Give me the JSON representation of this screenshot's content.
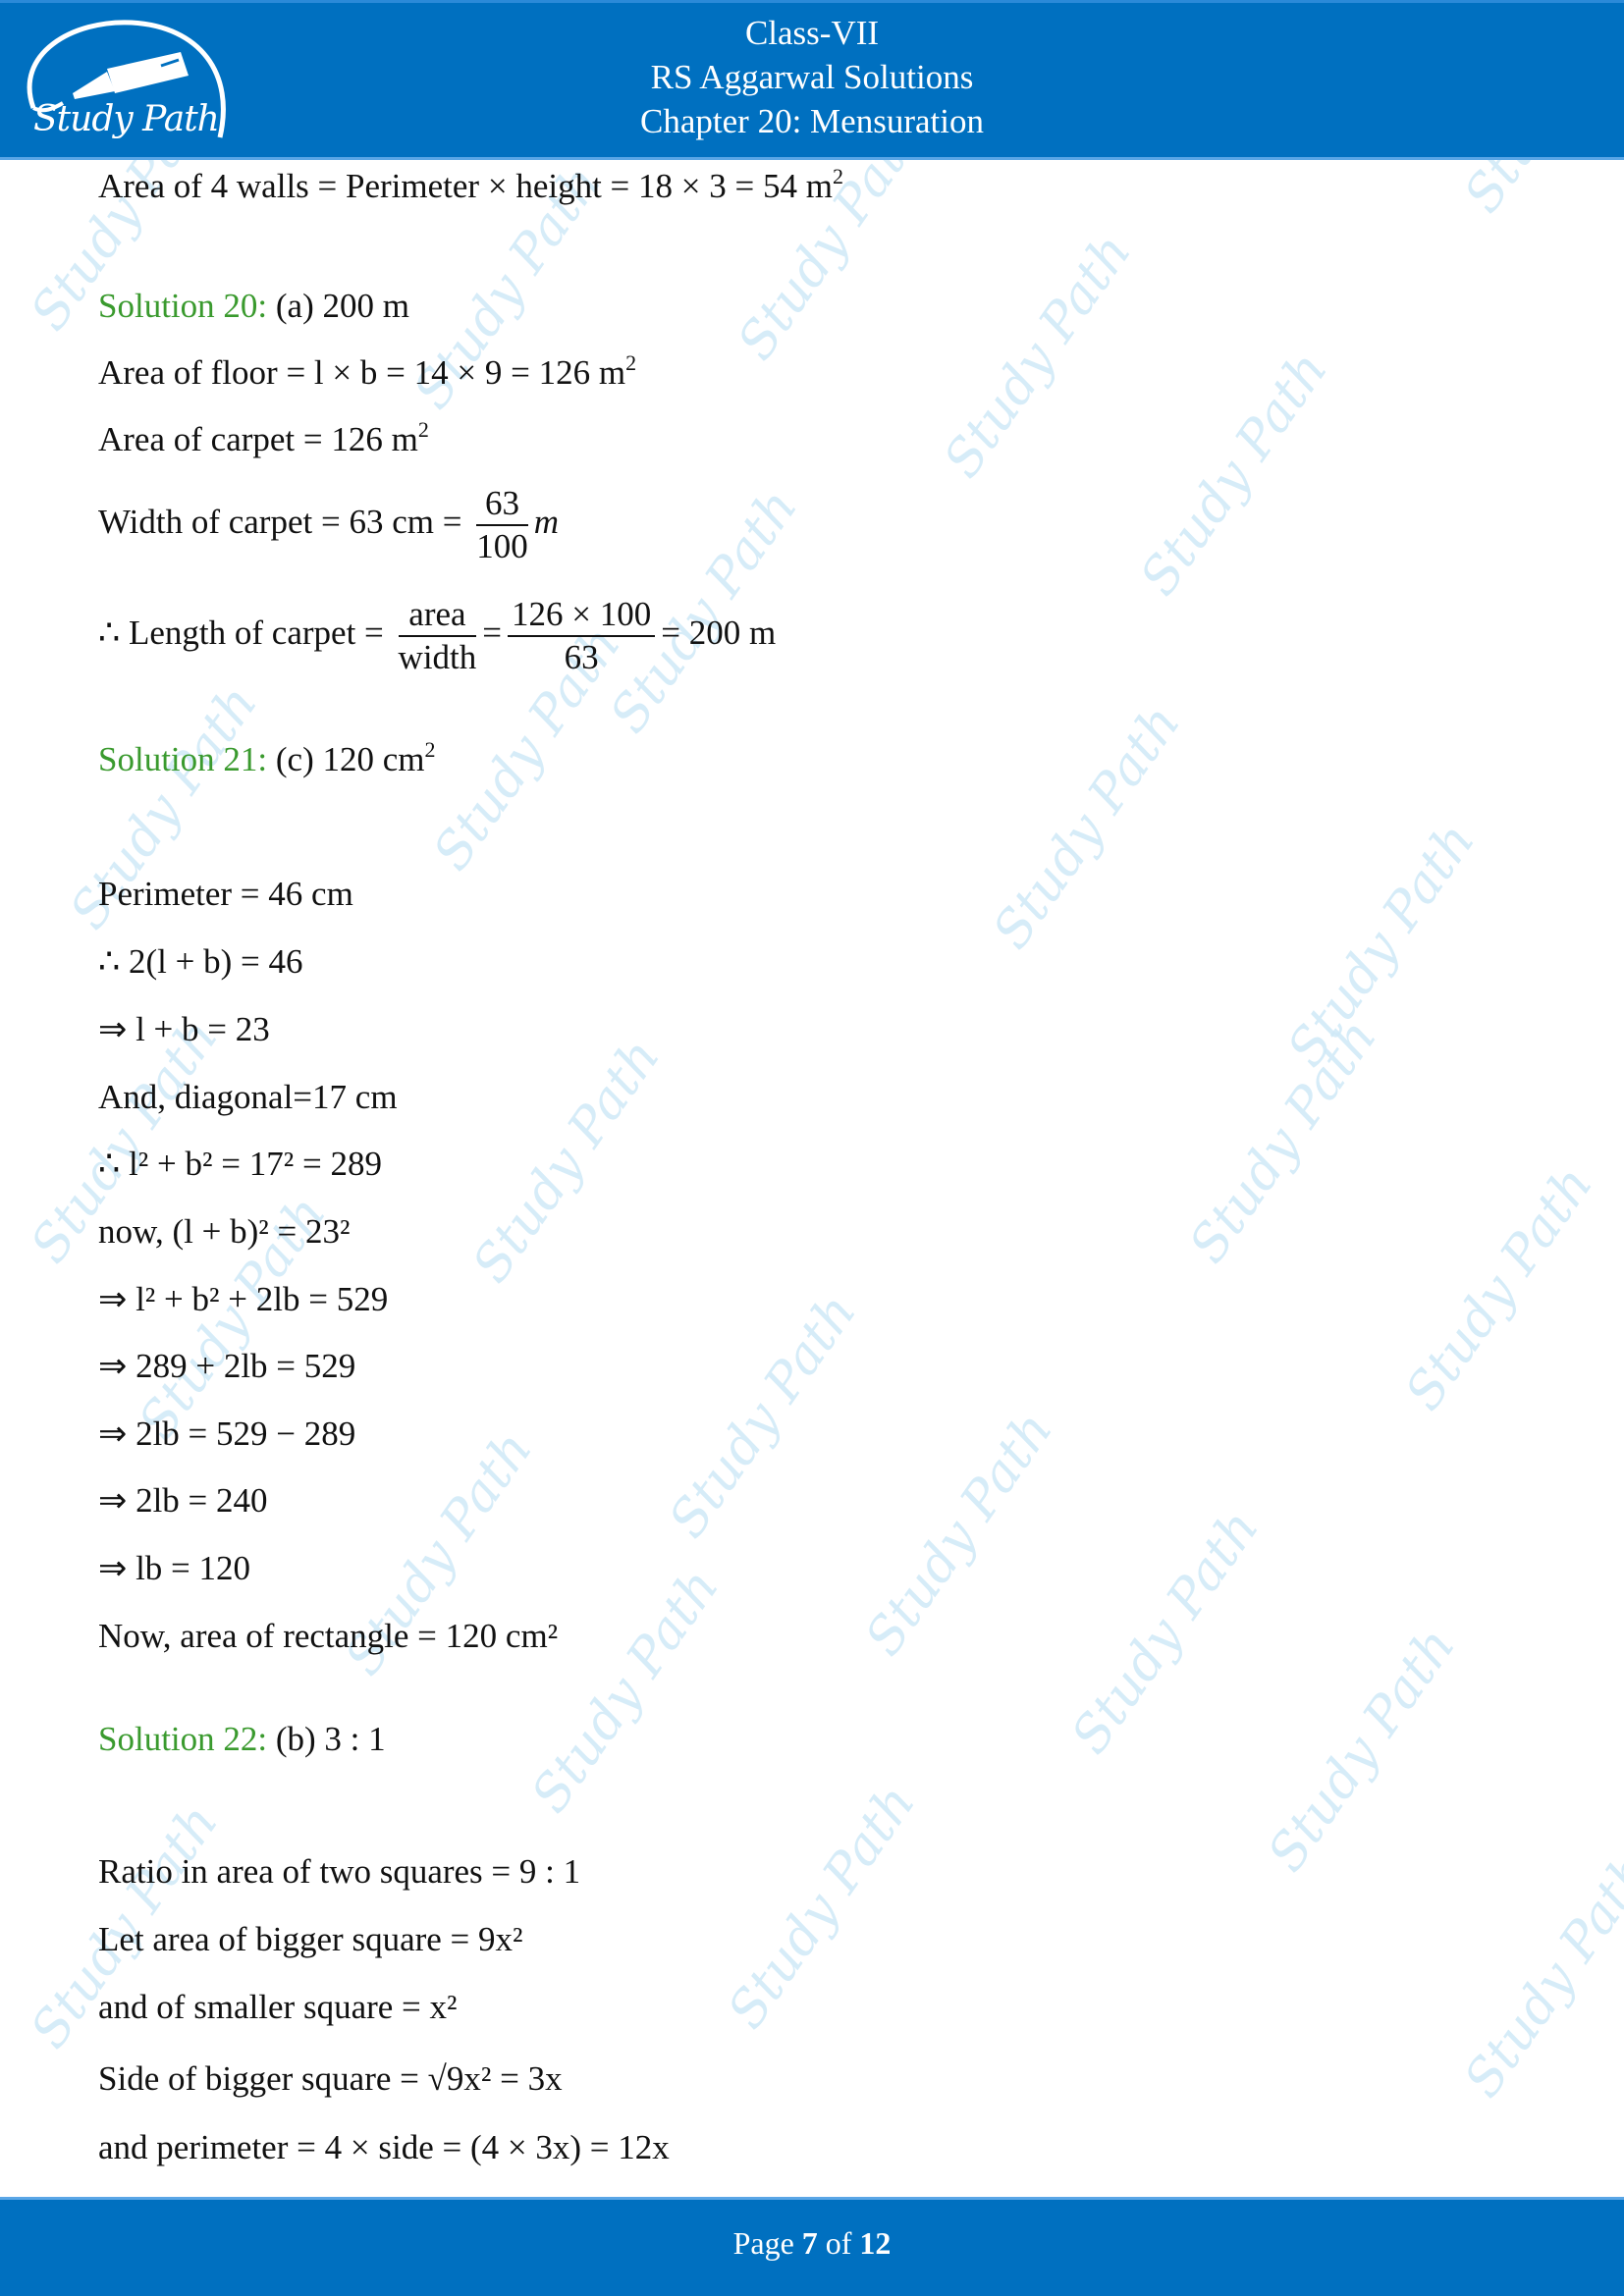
{
  "header": {
    "class": "Class-VII",
    "book": "RS Aggarwal Solutions",
    "chapter": "Chapter 20: Mensuration",
    "logo_text": "Study Path",
    "brand_color": "#0070c0"
  },
  "watermark_text": "Study Path",
  "content": {
    "area_walls": {
      "left": "Area of 4 walls = Perimeter × height = 18 × 3 = 54 m",
      "sup": "2"
    },
    "sol20": {
      "label": "Solution 20:",
      "answer": " (a) 200 m",
      "floor": {
        "text": "Area of floor = l × b = 14 × 9 = 126 m",
        "sup": "2"
      },
      "carpet_area": {
        "text": "Area of carpet = 126 m",
        "sup": "2"
      },
      "width": {
        "text": "Width of carpet = 63 cm = ",
        "num": "63",
        "den": "100",
        "unit": "m"
      },
      "length": {
        "text": "∴ Length of carpet = ",
        "num1": "area",
        "den1": "width",
        "eq": "=",
        "num2": "126 × 100",
        "den2": "63",
        "result": "= 200 m"
      }
    },
    "sol21": {
      "label": "Solution 21:",
      "answer": " (c) 120 cm",
      "answer_sup": "2",
      "lines": [
        "Perimeter = 46 cm",
        "∴ 2(l + b) = 46",
        "⇒ l + b = 23",
        "And, diagonal=17 cm",
        "∴ l² + b² = 17² = 289",
        "now, (l + b)² = 23²",
        "⇒ l² + b² + 2lb = 529",
        "⇒ 289 + 2lb = 529",
        "⇒ 2lb = 529 − 289",
        "⇒ 2lb = 240",
        "⇒ lb = 120",
        "Now, area of rectangle = 120 cm²"
      ]
    },
    "sol22": {
      "label": "Solution 22:",
      "answer": " (b) 3 : 1",
      "lines": [
        "Ratio in area of two squares =  9 : 1",
        "Let area of bigger square = 9x²",
        "and of smaller square = x²",
        "Side of bigger square  = √9x²  =  3x",
        "and perimeter = 4 ×  side = (4 × 3x) = 12x"
      ]
    }
  },
  "footer": {
    "prefix": "Page ",
    "current": "7",
    "middle": " of ",
    "total": "12"
  }
}
